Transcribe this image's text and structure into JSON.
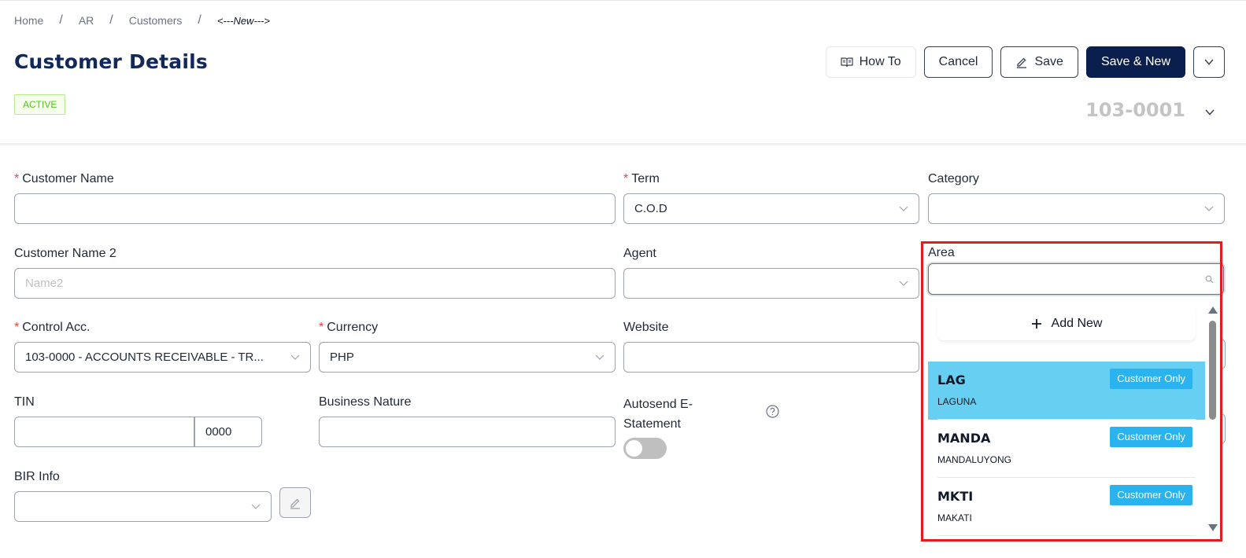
{
  "breadcrumb": {
    "items": [
      "Home",
      "AR",
      "Customers"
    ],
    "current": "<---New--->"
  },
  "page": {
    "title": "Customer Details",
    "status": "ACTIVE",
    "doc_number": "103-0001"
  },
  "toolbar": {
    "howto_label": "How To",
    "cancel_label": "Cancel",
    "save_label": "Save",
    "save_new_label": "Save & New"
  },
  "form": {
    "customer_name": {
      "label": "Customer Name",
      "value": ""
    },
    "term": {
      "label": "Term",
      "value": "C.O.D"
    },
    "category": {
      "label": "Category",
      "value": ""
    },
    "customer_name2": {
      "label": "Customer Name 2",
      "placeholder": "Name2"
    },
    "agent": {
      "label": "Agent",
      "value": ""
    },
    "area": {
      "label": "Area",
      "value": ""
    },
    "control_acc": {
      "label": "Control Acc.",
      "value": "103-0000 - ACCOUNTS RECEIVABLE - TR..."
    },
    "currency": {
      "label": "Currency",
      "value": "PHP"
    },
    "website": {
      "label": "Website",
      "value": ""
    },
    "tin": {
      "label": "TIN",
      "value": "",
      "branch": "0000"
    },
    "business_nature": {
      "label": "Business Nature",
      "value": ""
    },
    "autosend": {
      "label_line1": "Autosend E-",
      "label_line2": "Statement",
      "on": false
    },
    "bir_info": {
      "label": "BIR Info",
      "value": ""
    }
  },
  "area_dropdown": {
    "add_new_label": "Add New",
    "options": [
      {
        "code": "LAG",
        "name": "LAGUNA",
        "tag": "Customer Only",
        "selected": true
      },
      {
        "code": "MANDA",
        "name": "MANDALUYONG",
        "tag": "Customer Only",
        "selected": false
      },
      {
        "code": "MKTI",
        "name": "MAKATI",
        "tag": "Customer Only",
        "selected": false
      }
    ]
  },
  "colors": {
    "brand": "#0b1f4e",
    "highlight": "#e11d1d",
    "selected_row": "#67d0f2",
    "tag": "#2ab3ee"
  }
}
